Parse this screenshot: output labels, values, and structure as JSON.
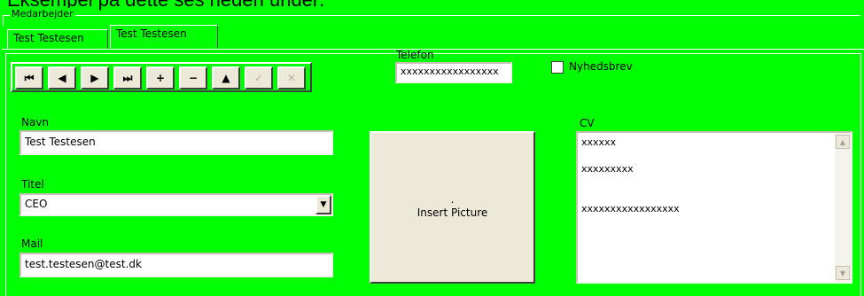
{
  "heading": "Eksempel på dette ses neden under:",
  "group": {
    "legend": "Medarbejder"
  },
  "tabs": [
    {
      "label": "Test Testesen",
      "active": false
    },
    {
      "label": "Test Testesen",
      "active": true
    }
  ],
  "navigator": {
    "buttons": [
      {
        "name": "first",
        "glyph": "⏮",
        "enabled": true
      },
      {
        "name": "prior",
        "glyph": "◀",
        "enabled": true
      },
      {
        "name": "next",
        "glyph": "▶",
        "enabled": true
      },
      {
        "name": "last",
        "glyph": "⏭",
        "enabled": true
      },
      {
        "name": "insert",
        "glyph": "+",
        "enabled": true
      },
      {
        "name": "delete",
        "glyph": "−",
        "enabled": true
      },
      {
        "name": "edit",
        "glyph": "▲",
        "enabled": true
      },
      {
        "name": "post",
        "glyph": "✓",
        "enabled": false
      },
      {
        "name": "cancel",
        "glyph": "✕",
        "enabled": false
      }
    ]
  },
  "telefon": {
    "label": "Telefon",
    "value": "xxxxxxxxxxxxxxxxx"
  },
  "nyhedsbrev": {
    "label": "Nyhedsbrev",
    "checked": false
  },
  "navn": {
    "label": "Navn",
    "value": "Test Testesen"
  },
  "titel": {
    "label": "Titel",
    "value": "CEO"
  },
  "mail": {
    "label": "Mail",
    "value": "test.testesen@test.dk"
  },
  "picture": {
    "dot": ".",
    "label": "Insert Picture"
  },
  "cv": {
    "label": "CV",
    "text": "xxxxxx\n\nxxxxxxxxx\n\n\nxxxxxxxxxxxxxxxxx"
  }
}
